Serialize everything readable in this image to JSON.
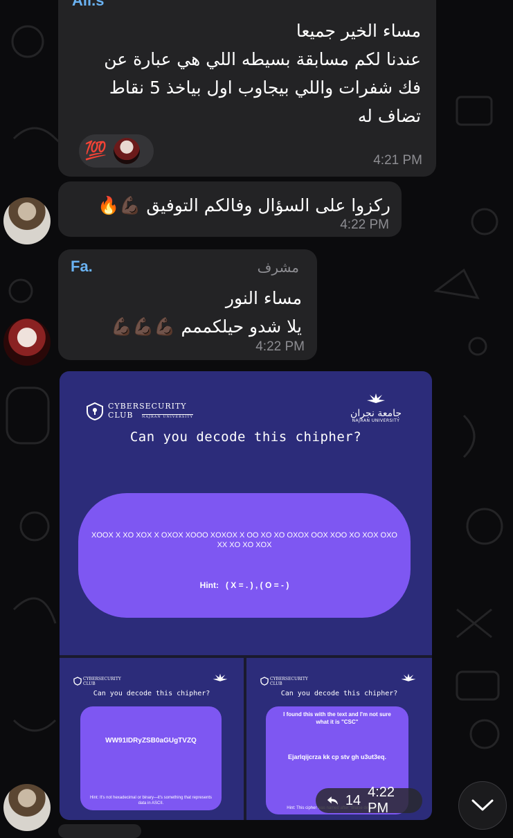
{
  "messages": [
    {
      "sender": "Ali.s",
      "lines": [
        "مساء الخير جميعا",
        "عندنا لكم مسابقة بسيطه اللي هي عبارة عن",
        "فك شفرات واللي بيجاوب اول بياخذ 5 نقاط",
        "تضاف له"
      ],
      "reaction_emoji": "💯",
      "time": "4:21 PM"
    },
    {
      "text": "ركزوا على السؤال وفالكم التوفيق",
      "emoji": "💪🏿🔥",
      "time": "4:22 PM"
    },
    {
      "sender": "Fa.",
      "role": "مشرف",
      "lines": [
        "مساء النور",
        "يلا شدو حيلكممم"
      ],
      "emoji": "💪🏿💪🏿💪🏿",
      "time": "4:22 PM"
    }
  ],
  "media": {
    "main": {
      "club_line1": "CYBERSECURITY",
      "club_line2": "CLUB",
      "club_sub": "NAJRAN UNIVERSITY",
      "uni_arabic": "جامعة نجران",
      "uni_english": "NAJRAN UNIVERSITY",
      "title": "Can you decode this chipher?",
      "cipher": "XOOX X XO XOX X OXOX XOOO XOXOX X OO XO XO OXOX OOX XOO XO XOX OXO XX XO XO XOX",
      "hint": "Hint:   ( X = . ) , ( O = - )"
    },
    "left": {
      "club_line1": "CYBERSECURITY",
      "club_line2": "CLUB",
      "title": "Can you decode this chipher?",
      "cipher": "WW91IDRyZSB0aGUgTVZQ",
      "hint": "Hint: It's not hexadecimal or binary—it's something that represents data in ASCII."
    },
    "right": {
      "club_line1": "CYBERSECURITY",
      "club_line2": "CLUB",
      "title": "Can you decode this chipher?",
      "note": "I found this with the text and I'm not sure what it is \"CSC\"",
      "cipher": "Ejarlqijcrza kk cp stv gh u3ut3eq.",
      "hint": "Hint: This cipher was named after \"Blaise de Vigenère\""
    },
    "replies": "14",
    "time": "4:22 PM"
  },
  "colors": {
    "bubble": "#232325",
    "sender_blue": "#6ab2f2",
    "media_bg": "#2c2c7a",
    "pill": "#7e57f2"
  },
  "icons": [
    "reply-arrow-icon",
    "chevron-down-icon",
    "shield-keyhole-icon",
    "university-crest-icon"
  ]
}
